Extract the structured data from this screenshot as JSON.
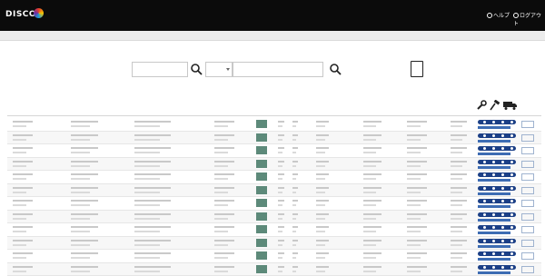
{
  "header": {
    "brand": "DISCO",
    "help_label": "ヘルプ",
    "logout_label": "ログアウト"
  },
  "search": {
    "keyword_placeholder": "",
    "category_value": "",
    "code_placeholder": "",
    "option_label": ""
  },
  "table": {
    "columns": [],
    "row_count": 12
  },
  "colors": {
    "header_bg": "#0b0b0b",
    "accent": "#1b3f86"
  }
}
